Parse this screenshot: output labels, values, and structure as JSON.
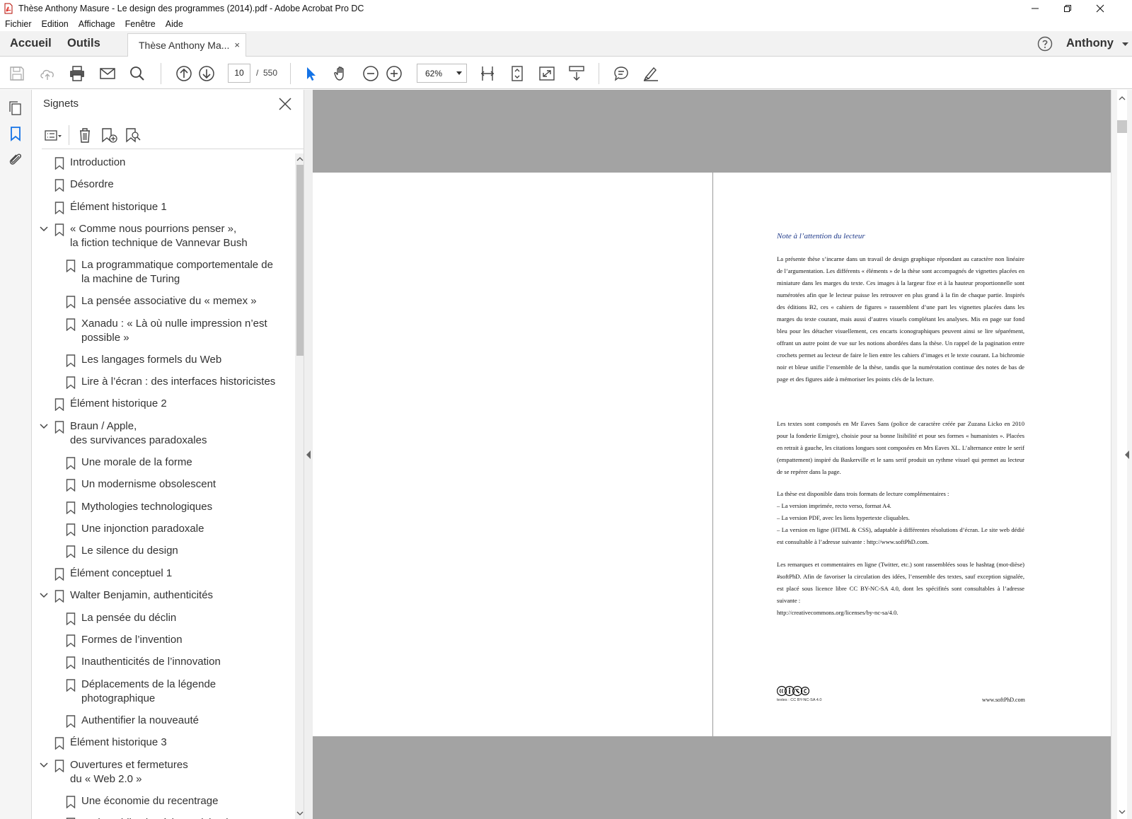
{
  "window": {
    "title": "Thèse Anthony Masure - Le design des programmes (2014).pdf - Adobe Acrobat Pro DC",
    "icons": [
      "pdf-app-icon",
      "minimize-icon",
      "restore-icon",
      "close-icon"
    ]
  },
  "menu": [
    "Fichier",
    "Edition",
    "Affichage",
    "Fenêtre",
    "Aide"
  ],
  "nav": {
    "home": "Accueil",
    "tools": "Outils",
    "doc_tab": "Thèse Anthony Ma...",
    "doc_tab_close": "×",
    "user": "Anthony"
  },
  "toolbar": {
    "page_current": "10",
    "page_separator": "/",
    "page_total": "550",
    "zoom": "62%"
  },
  "sidebar": {
    "title": "Signets",
    "bookmarks": [
      {
        "level": 1,
        "label": "Introduction"
      },
      {
        "level": 1,
        "label": "Désordre"
      },
      {
        "level": 1,
        "label": "Élément historique 1"
      },
      {
        "level": 1,
        "expanded": true,
        "label": "« Comme nous pourrions penser »,",
        "label2": "la fiction technique de Vannevar Bush"
      },
      {
        "level": 2,
        "label": "La programmatique comportementale de",
        "label2": "la machine de Turing"
      },
      {
        "level": 2,
        "label": "La pensée associative du « memex »"
      },
      {
        "level": 2,
        "label": "Xanadu : « Là où nulle impression n’est",
        "label2": "possible »"
      },
      {
        "level": 2,
        "label": "Les langages formels du Web"
      },
      {
        "level": 2,
        "label": "Lire à l’écran : des interfaces historicistes"
      },
      {
        "level": 1,
        "label": "Élément historique 2"
      },
      {
        "level": 1,
        "expanded": true,
        "label": "Braun / Apple,",
        "label2": "des survivances paradoxales"
      },
      {
        "level": 2,
        "label": "Une morale de la forme"
      },
      {
        "level": 2,
        "label": "Un modernisme obsolescent"
      },
      {
        "level": 2,
        "label": "Mythologies technologiques"
      },
      {
        "level": 2,
        "label": "Une injonction paradoxale"
      },
      {
        "level": 2,
        "label": "Le silence du design"
      },
      {
        "level": 1,
        "label": "Élément conceptuel 1"
      },
      {
        "level": 1,
        "expanded": true,
        "label": "Walter Benjamin, authenticités"
      },
      {
        "level": 2,
        "label": "La pensée du déclin"
      },
      {
        "level": 2,
        "label": "Formes de l’invention"
      },
      {
        "level": 2,
        "label": "Inauthenticités de l’innovation"
      },
      {
        "level": 2,
        "label": "Déplacements de la légende",
        "label2": "photographique"
      },
      {
        "level": 2,
        "label": "Authentifier la nouveauté"
      },
      {
        "level": 1,
        "label": "Élément historique 3"
      },
      {
        "level": 1,
        "expanded": true,
        "label": "Ouvertures et fermetures",
        "label2": "du « Web 2.0 »"
      },
      {
        "level": 2,
        "label": "Une économie du recentrage"
      },
      {
        "level": 2,
        "label": "De la publication à la participation"
      }
    ]
  },
  "document": {
    "heading": "Note à l’attention du lecteur",
    "para1": "La présente thèse s’incarne dans un travail de design graphique répondant au caractère non linéaire de l’argumentation. Les différents « éléments » de la thèse sont accompagnés de vignettes placées en miniature dans les marges du texte. Ces images à la largeur fixe et à la hauteur proportionnelle sont numérotées afin que le lecteur puisse les retrouver en plus grand à la fin de chaque partie. Inspirés des éditions B2, ces « cahiers de figures » rassemblent d’une part les vignettes placées dans les marges du texte courant, mais aussi d’autres visuels complétant les analyses. Mis en page sur fond bleu pour les détacher visuellement, ces encarts iconographiques peuvent ainsi se lire séparément, offrant un autre point de vue sur les notions abordées dans la thèse. Un rappel de la pagination entre crochets permet au lecteur de faire le lien entre les cahiers d’images et le texte courant. La bichromie noir et bleue unifie l’ensemble de la thèse, tandis que la numérotation continue des notes de bas de page et des figures aide à mémoriser les points clés de la lecture.",
    "para2": "Les textes sont composés en Mr Eaves Sans (police de caractère créée par Zuzana Licko en 2010 pour la fonderie Emigre), choisie pour sa bonne lisibilité et pour ses formes « humanistes ». Placées en retrait à gauche, les citations longues sont composées en Mrs Eaves XL. L’alternance entre le serif (empattement) inspiré du Baskerville et le sans serif produit un rythme visuel qui permet au lecteur de se repérer dans la page.",
    "para3_intro": "La thèse est disponible dans trois formats de lecture complémentaires :",
    "para3_l1": "– La version imprimée, recto verso, format A4.",
    "para3_l2": "– La version PDF, avec les liens hypertexte cliquables.",
    "para3_l3": "– La version en ligne (HTML & CSS), adaptable à différentes résolutions d’écran. Le site web dédié est consultable à l’adresse suivante : http://www.softPhD.com.",
    "para4": "Les remarques et commentaires en ligne (Twitter, etc.) sont rassemblées sous le hashtag (mot-dièse) #softPhD. Afin de favoriser la circulation des idées, l’ensemble des textes, sauf exception signalée, est placé sous licence libre CC BY-NC-SA 4.0, dont les spécifités sont consultables à l’adresse suivante :",
    "para4_url": "http://creativecommons.org/licenses/by-nc-sa/4.0.",
    "license_note": "textes : CC BY-NC-SA 4.0",
    "site": "www.softPhD.com"
  }
}
